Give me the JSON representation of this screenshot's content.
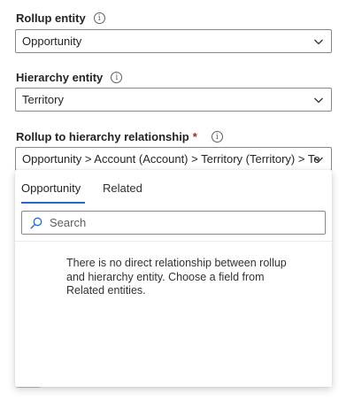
{
  "rollup_entity": {
    "label": "Rollup entity",
    "value": "Opportunity",
    "info_icon": "info-icon"
  },
  "hierarchy_entity": {
    "label": "Hierarchy entity",
    "value": "Territory",
    "info_icon": "info-icon"
  },
  "relationship": {
    "label": "Rollup to hierarchy relationship",
    "required_marker": "*",
    "value": "Opportunity > Account (Account) > Territory (Territory) > Te",
    "info_icon": "info-icon"
  },
  "dropdown": {
    "tabs": [
      {
        "label": "Opportunity",
        "selected": true
      },
      {
        "label": "Related",
        "selected": false
      }
    ],
    "search": {
      "placeholder": "Search",
      "icon": "search-icon"
    },
    "message": "There is no direct relationship between rollup and hierarchy entity. Choose a field from Related entities."
  },
  "colors": {
    "accent": "#2b66c8",
    "required": "#a4262c",
    "border": "#8a8886"
  }
}
